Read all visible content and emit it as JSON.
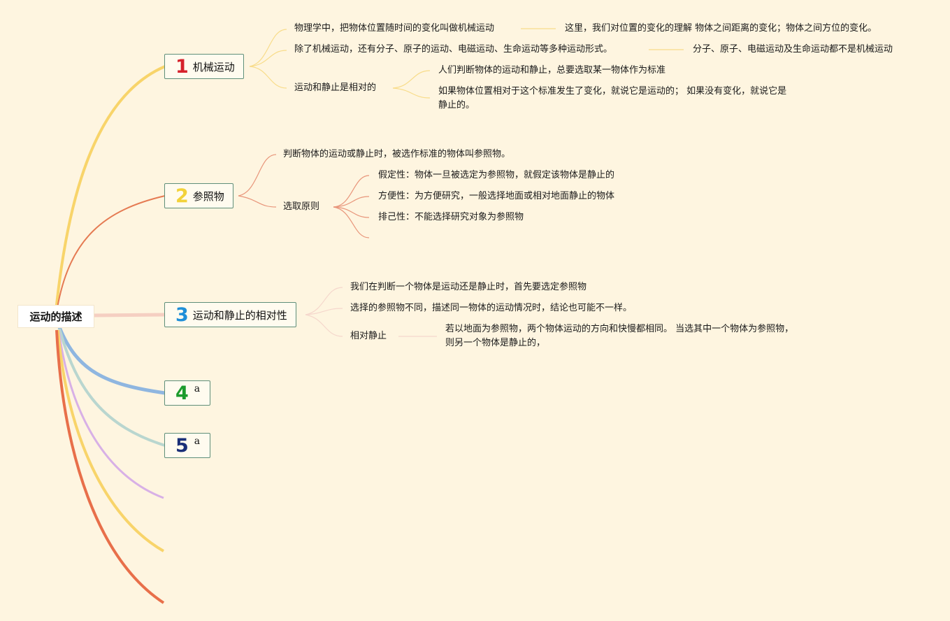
{
  "root": {
    "label": "运动的描述"
  },
  "colors": {
    "background": "#fef5e0",
    "yellow": "#f8d46a",
    "orange": "#e57a52",
    "pink": "#f5cfc2",
    "blue": "#8fb6e0",
    "teal": "#b9d6cf",
    "purple": "#d8b0e6",
    "red": "#e86f4a",
    "num1": "#d6222c",
    "num2": "#f2d23a",
    "num3": "#1f8fd8",
    "num4": "#1c9b2c",
    "num5": "#1a2f78"
  },
  "branches": [
    {
      "number": "1",
      "label": "机械运动",
      "children": [
        {
          "text": "物理学中，把物体位置随时间的变化叫做机械运动",
          "note": "这里，我们对位置的变化的理解 物体之间距离的变化；物体之间方位的变化。"
        },
        {
          "text": "除了机械运动，还有分子、原子的运动、电磁运动、生命运动等多种运动形式。",
          "note": "分子、原子、电磁运动及生命运动都不是机械运动"
        },
        {
          "text": "运动和静止是相对的",
          "subs": [
            "人们判断物体的运动和静止，总要选取某一物体作为标准",
            "如果物体位置相对于这个标准发生了变化，就说它是运动的； 如果没有变化，就说它是静止的。"
          ]
        }
      ]
    },
    {
      "number": "2",
      "label": "参照物",
      "children": [
        {
          "text": "判断物体的运动或静止时，被选作标准的物体叫参照物。"
        },
        {
          "text": "选取原则",
          "subs": [
            "假定性：物体一旦被选定为参照物，就假定该物体是静止的",
            "方便性：为方便研究，一般选择地面或相对地面静止的物体",
            "排己性：不能选择研究对象为参照物"
          ]
        }
      ]
    },
    {
      "number": "3",
      "label": "运动和静止的相对性",
      "children": [
        {
          "text": "我们在判断一个物体是运动还是静止时，首先要选定参照物"
        },
        {
          "text": "选择的参照物不同，描述同一物体的运动情况时，结论也可能不一样。"
        },
        {
          "text": "相对静止",
          "note": "若以地面为参照物，两个物体运动的方向和快慢都相同。 当选其中一个物体为参照物，则另一个物体是静止的，"
        }
      ]
    },
    {
      "number": "4",
      "label": "a"
    },
    {
      "number": "5",
      "label": "a"
    }
  ]
}
